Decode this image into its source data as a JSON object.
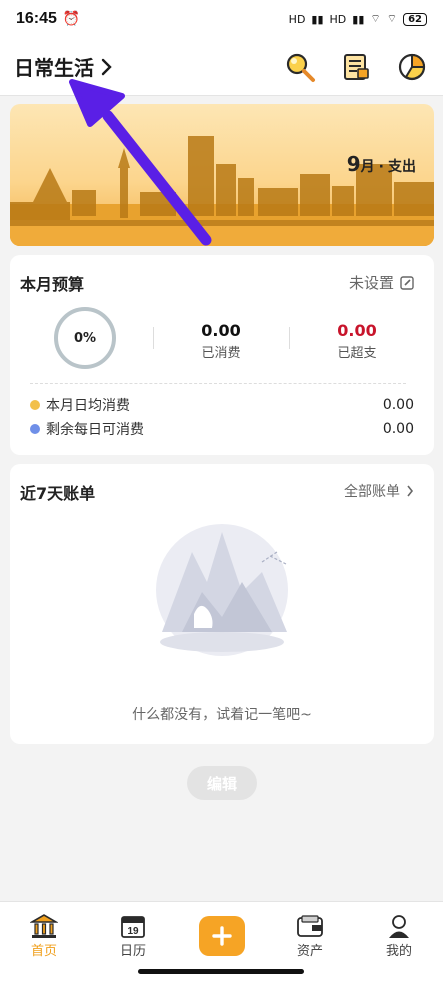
{
  "status_bar": {
    "time": "16:45",
    "signal1": "HD",
    "signal2": "HD",
    "battery": "62"
  },
  "header": {
    "book_title": "日常生活",
    "icons": [
      "search-icon",
      "bill-list-icon",
      "chart-icon"
    ]
  },
  "banner": {
    "month": "9",
    "month_suffix": "月",
    "separator": "·",
    "kind": "支出"
  },
  "budget": {
    "title": "本月预算",
    "action_label": "未设置",
    "progress": "0%",
    "spent_value": "0.00",
    "spent_label": "已消费",
    "over_value": "0.00",
    "over_label": "已超支",
    "rows": [
      {
        "label": "本月日均消费",
        "value": "0.00",
        "color": "#f2c04a"
      },
      {
        "label": "剩余每日可消费",
        "value": "0.00",
        "color": "#6f8fe8"
      }
    ]
  },
  "recent": {
    "title": "近7天账单",
    "action_label": "全部账单",
    "empty_text": "什么都没有，试着记一笔吧~"
  },
  "edit_button": "编辑",
  "tabs": [
    {
      "label": "首页",
      "icon": "home-bank-icon",
      "active": true
    },
    {
      "label": "日历",
      "icon": "calendar-icon",
      "day": "19"
    },
    {
      "label": "资产",
      "icon": "wallet-icon"
    },
    {
      "label": "我的",
      "icon": "profile-icon"
    }
  ],
  "colors": {
    "accent": "#f6a425",
    "over_red": "#c8142b",
    "annotation_arrow": "#5a1fe6"
  }
}
